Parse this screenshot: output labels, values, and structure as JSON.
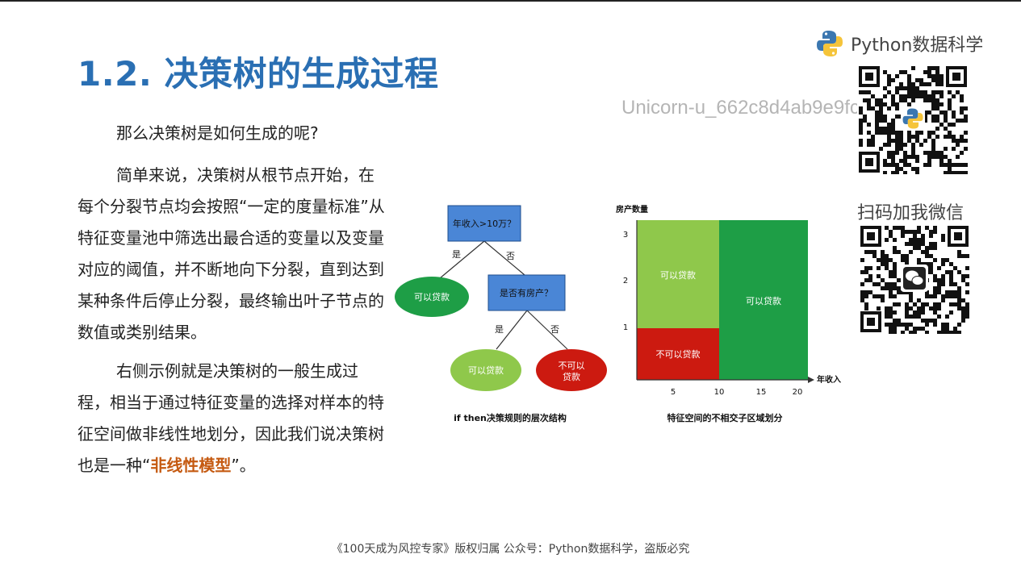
{
  "slide": {
    "title": "1.2. 决策树的生成过程",
    "para1": "那么决策树是如何生成的呢?",
    "para2": "简单来说，决策树从根节点开始，在每个分裂节点均会按照“一定的度量标准”从特征变量池中筛选出最合适的变量以及变量对应的阈值，并不断地向下分裂，直到达到某种条件后停止分裂，最终输出叶子节点的数值或类别结果。",
    "para3_pre": "右侧示例就是决策树的一般生成过程，相当于通过特征变量的选择对样本的特征空间做非线性地划分，因此我们说决策树也是一种“",
    "para3_highlight": "非线性模型",
    "para3_post": "”。"
  },
  "watermark": "Unicorn-u_662c8d4ab9e9fc9c11e172lZ",
  "brand": {
    "name": "Python数据科学",
    "icon": "python-logo-icon"
  },
  "wechat": {
    "label": "扫码加我微信",
    "icon": "wechat-icon"
  },
  "tree": {
    "root": "年收入>10万？",
    "yes": "是",
    "no": "否",
    "leaf_yes": "可以贷款",
    "node2": "是否有房产？",
    "yes2": "是",
    "no2": "否",
    "leaf2_yes": "可以贷款",
    "leaf2_no_line1": "不可以",
    "leaf2_no_line2": "贷款",
    "caption": "if then决策规则的层次结构"
  },
  "space": {
    "ylabel": "房产数量",
    "xlabel": "年收入",
    "yticks": [
      "1",
      "2",
      "3"
    ],
    "xticks": [
      "5",
      "10",
      "15",
      "20"
    ],
    "region_top_left": "可以贷款",
    "region_bottom_left": "不可以贷款",
    "region_right": "可以贷款",
    "caption": "特征空间的不相交子区域划分",
    "colors": {
      "light_green": "#8fc84b",
      "dark_green": "#1e9e46",
      "red": "#cc1a10",
      "blue": "#4a86d6"
    }
  },
  "footer": "《100天成为风控专家》版权归属 公众号：Python数据科学，盗版必究"
}
